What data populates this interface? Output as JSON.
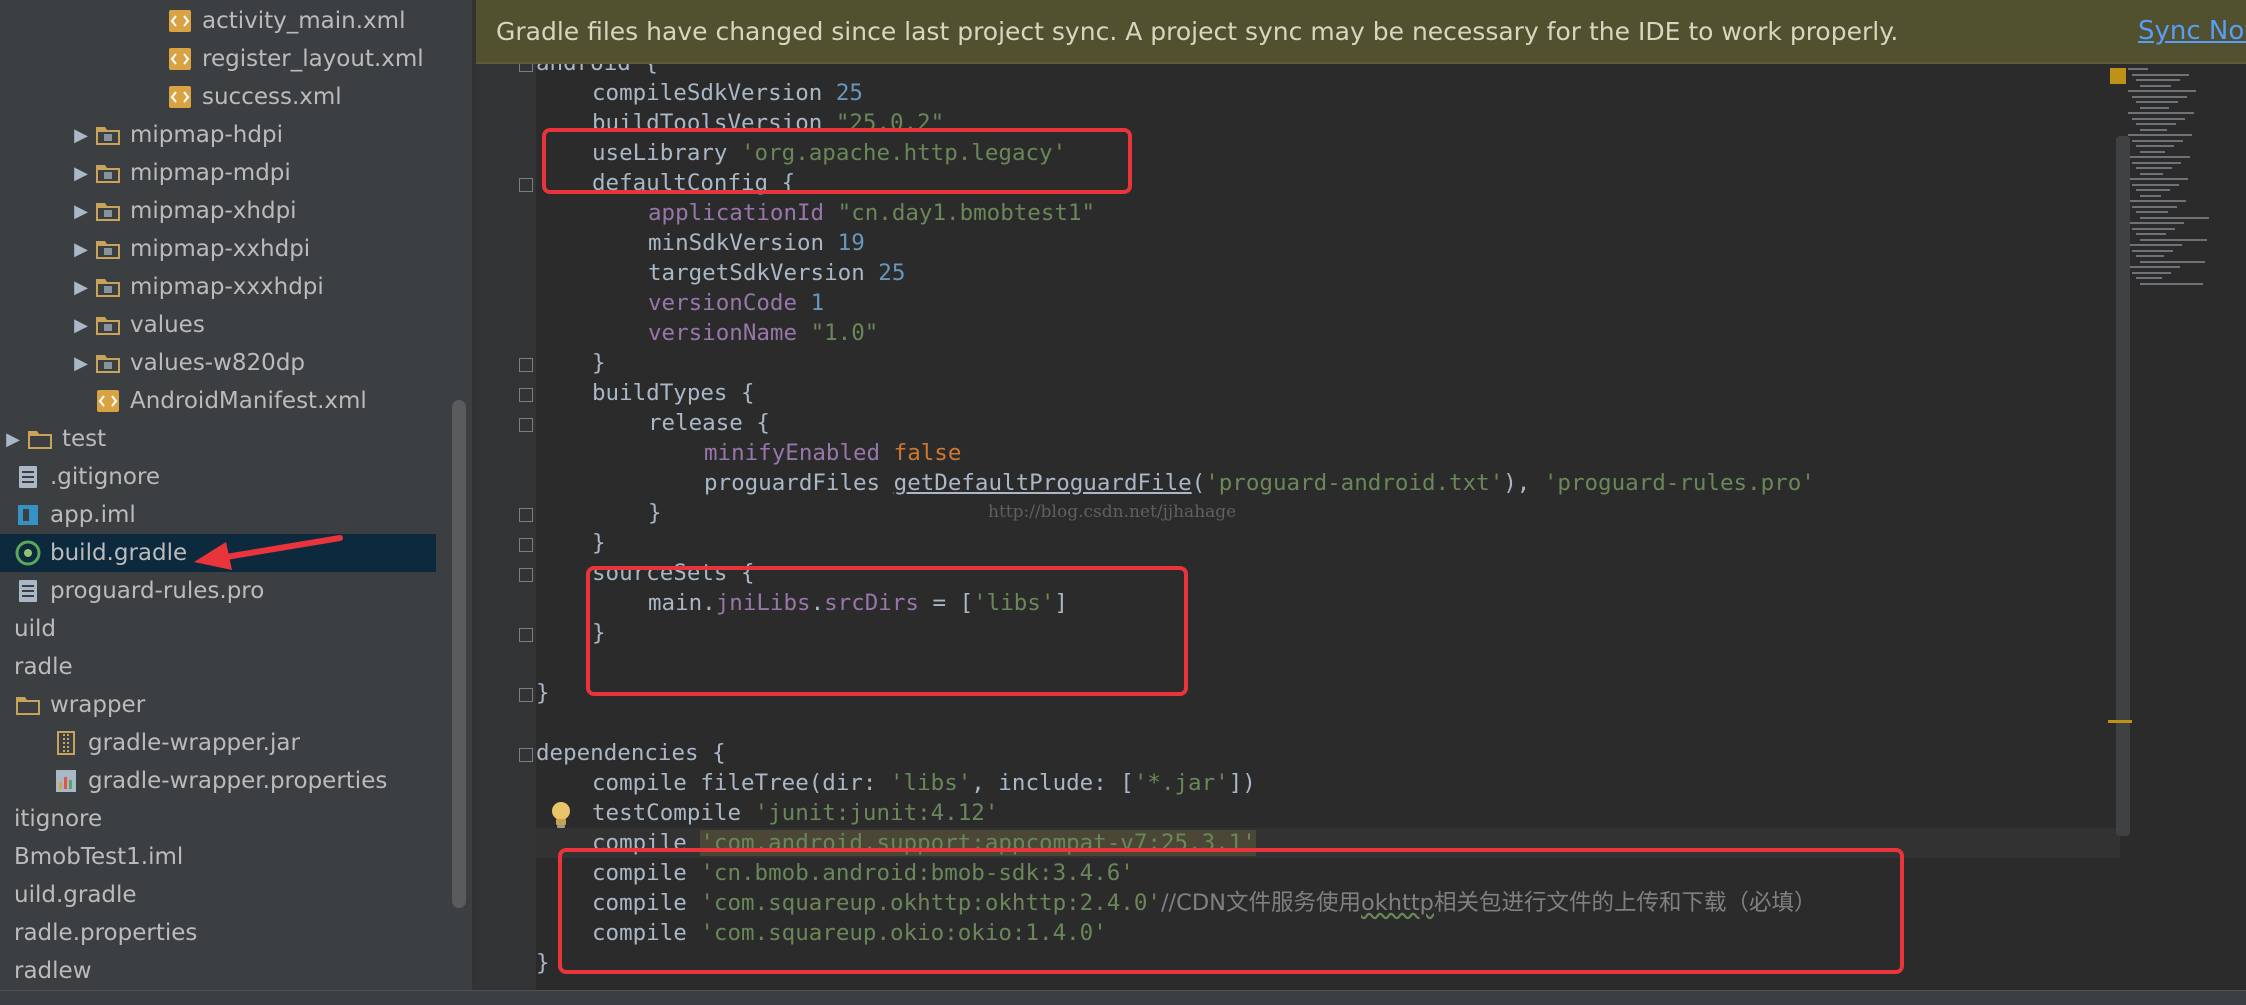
{
  "notification": {
    "message": "Gradle files have changed since last project sync. A project sync may be necessary for the IDE to work properly.",
    "action": "Sync Now"
  },
  "tree": [
    {
      "label": "activity_main.xml",
      "icon": "xml-file-icon",
      "expand": "none"
    },
    {
      "label": "register_layout.xml",
      "icon": "xml-file-icon",
      "expand": "none"
    },
    {
      "label": "success.xml",
      "icon": "xml-file-icon",
      "expand": "none"
    },
    {
      "label": "mipmap-hdpi",
      "icon": "resource-folder-icon",
      "expand": "collapsed"
    },
    {
      "label": "mipmap-mdpi",
      "icon": "resource-folder-icon",
      "expand": "collapsed"
    },
    {
      "label": "mipmap-xhdpi",
      "icon": "resource-folder-icon",
      "expand": "collapsed"
    },
    {
      "label": "mipmap-xxhdpi",
      "icon": "resource-folder-icon",
      "expand": "collapsed"
    },
    {
      "label": "mipmap-xxxhdpi",
      "icon": "resource-folder-icon",
      "expand": "collapsed"
    },
    {
      "label": "values",
      "icon": "resource-folder-icon",
      "expand": "collapsed"
    },
    {
      "label": "values-w820dp",
      "icon": "resource-folder-icon",
      "expand": "collapsed"
    },
    {
      "label": "AndroidManifest.xml",
      "icon": "manifest-file-icon",
      "expand": "none"
    },
    {
      "label": "test",
      "icon": "folder-icon",
      "expand": "collapsed"
    },
    {
      "label": ".gitignore",
      "icon": "text-file-icon",
      "expand": "none"
    },
    {
      "label": "app.iml",
      "icon": "iml-file-icon",
      "expand": "none"
    },
    {
      "label": "build.gradle",
      "icon": "gradle-file-icon",
      "expand": "none",
      "selected": true
    },
    {
      "label": "proguard-rules.pro",
      "icon": "text-file-icon",
      "expand": "none"
    },
    {
      "label": "uild",
      "icon": "",
      "expand": "none"
    },
    {
      "label": "radle",
      "icon": "",
      "expand": "none"
    },
    {
      "label": "wrapper",
      "icon": "folder-icon",
      "expand": "none"
    },
    {
      "label": "gradle-wrapper.jar",
      "icon": "jar-file-icon",
      "expand": "none"
    },
    {
      "label": "gradle-wrapper.properties",
      "icon": "properties-file-icon",
      "expand": "none"
    },
    {
      "label": "itignore",
      "icon": "",
      "expand": "none"
    },
    {
      "label": "BmobTest1.iml",
      "icon": "",
      "expand": "none"
    },
    {
      "label": "uild.gradle",
      "icon": "",
      "expand": "none"
    },
    {
      "label": "radle.properties",
      "icon": "",
      "expand": "none"
    },
    {
      "label": "radlew",
      "icon": "",
      "expand": "none"
    }
  ],
  "code": [
    {
      "indent": 0,
      "tokens": [
        [
          "t",
          "android {"
        ]
      ]
    },
    {
      "indent": 1,
      "tokens": [
        [
          "t",
          "compileSdkVersion "
        ],
        [
          "n",
          "25"
        ]
      ]
    },
    {
      "indent": 1,
      "tokens": [
        [
          "t",
          "buildToolsVersion "
        ],
        [
          "s",
          "\"25.0.2\""
        ]
      ]
    },
    {
      "indent": 1,
      "tokens": [
        [
          "t",
          "useLibrary "
        ],
        [
          "s",
          "'org.apache.http.legacy'"
        ]
      ]
    },
    {
      "indent": 1,
      "tokens": [
        [
          "t",
          "defaultConfig {"
        ]
      ]
    },
    {
      "indent": 2,
      "tokens": [
        [
          "p",
          "applicationId "
        ],
        [
          "s",
          "\"cn.day1.bmobtest1\""
        ]
      ]
    },
    {
      "indent": 2,
      "tokens": [
        [
          "t",
          "minSdkVersion "
        ],
        [
          "n",
          "19"
        ]
      ]
    },
    {
      "indent": 2,
      "tokens": [
        [
          "t",
          "targetSdkVersion "
        ],
        [
          "n",
          "25"
        ]
      ]
    },
    {
      "indent": 2,
      "tokens": [
        [
          "p",
          "versionCode "
        ],
        [
          "n",
          "1"
        ]
      ]
    },
    {
      "indent": 2,
      "tokens": [
        [
          "p",
          "versionName "
        ],
        [
          "s",
          "\"1.0\""
        ]
      ]
    },
    {
      "indent": 1,
      "tokens": [
        [
          "t",
          "}"
        ]
      ]
    },
    {
      "indent": 1,
      "tokens": [
        [
          "t",
          "buildTypes {"
        ]
      ]
    },
    {
      "indent": 2,
      "tokens": [
        [
          "t",
          "release {"
        ]
      ]
    },
    {
      "indent": 3,
      "tokens": [
        [
          "p",
          "minifyEnabled "
        ],
        [
          "k",
          "false"
        ]
      ]
    },
    {
      "indent": 3,
      "tokens": [
        [
          "t",
          "proguardFiles "
        ],
        [
          "m",
          "getDefaultProguardFile"
        ],
        [
          "t",
          "("
        ],
        [
          "s",
          "'proguard-android.txt'"
        ],
        [
          "t",
          "), "
        ],
        [
          "s",
          "'proguard-rules.pro'"
        ]
      ]
    },
    {
      "indent": 2,
      "tokens": [
        [
          "t",
          "}"
        ]
      ]
    },
    {
      "indent": 1,
      "tokens": [
        [
          "t",
          "}"
        ]
      ]
    },
    {
      "indent": 1,
      "tokens": [
        [
          "t",
          "sourceSets {"
        ]
      ]
    },
    {
      "indent": 2,
      "tokens": [
        [
          "t",
          "main."
        ],
        [
          "p",
          "jniLibs"
        ],
        [
          "t",
          "."
        ],
        [
          "p",
          "srcDirs"
        ],
        [
          "t",
          " = ["
        ],
        [
          "s",
          "'libs'"
        ],
        [
          "t",
          "]"
        ]
      ]
    },
    {
      "indent": 1,
      "tokens": [
        [
          "t",
          "}"
        ]
      ]
    },
    {
      "indent": 0,
      "tokens": [
        [
          "t",
          ""
        ]
      ]
    },
    {
      "indent": 0,
      "tokens": [
        [
          "t",
          "}"
        ]
      ]
    },
    {
      "indent": 0,
      "tokens": [
        [
          "t",
          ""
        ]
      ]
    },
    {
      "indent": 0,
      "tokens": [
        [
          "t",
          "dependencies {"
        ]
      ]
    },
    {
      "indent": 1,
      "tokens": [
        [
          "t",
          "compile fileTree(dir: "
        ],
        [
          "s",
          "'libs'"
        ],
        [
          "t",
          ", include: ["
        ],
        [
          "s",
          "'*.jar'"
        ],
        [
          "t",
          "])"
        ]
      ]
    },
    {
      "indent": 1,
      "tokens": [
        [
          "t",
          "testCompile "
        ],
        [
          "s",
          "'junit:junit:4.12'"
        ]
      ]
    },
    {
      "indent": 1,
      "current": true,
      "tokens": [
        [
          "t",
          "compile "
        ],
        [
          "h",
          "'com.android.support:appcompat-v7:25.3.1'"
        ]
      ]
    },
    {
      "indent": 1,
      "tokens": [
        [
          "t",
          "compile "
        ],
        [
          "s",
          "'cn.bmob.android:bmob-sdk:3.4.6'"
        ]
      ]
    },
    {
      "indent": 1,
      "tokens": [
        [
          "t",
          "compile "
        ],
        [
          "s",
          "'com.squareup.okhttp:okhttp:2.4.0'"
        ],
        [
          "c",
          "//CDN文件服务使用"
        ],
        [
          "w",
          "okhttp"
        ],
        [
          "c",
          "相关包进行文件的上传和下载（必填）"
        ]
      ]
    },
    {
      "indent": 1,
      "tokens": [
        [
          "t",
          "compile "
        ],
        [
          "s",
          "'com.squareup.okio:okio:1.4.0'"
        ]
      ]
    },
    {
      "indent": 0,
      "tokens": [
        [
          "t",
          "}"
        ]
      ]
    }
  ],
  "watermark": "http://blog.csdn.net/jjhahage",
  "colors": {
    "annotation_red": "#e8343a",
    "selection": "#0d293e",
    "string": "#6a8759",
    "number": "#6897bb",
    "keyword": "#cc7832",
    "property": "#9876aa"
  }
}
